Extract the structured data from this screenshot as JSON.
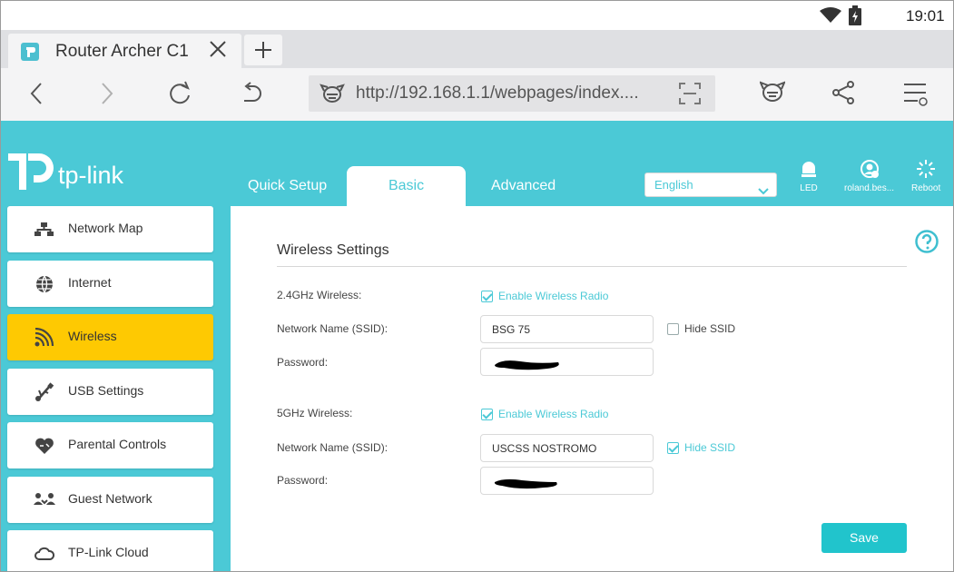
{
  "status": {
    "time": "19:01"
  },
  "browser": {
    "tab_title": "Router Archer C1",
    "url": "http://192.168.1.1/webpages/index...."
  },
  "router": {
    "logo_text": "tp-link",
    "nav": {
      "quick": "Quick Setup",
      "basic": "Basic",
      "advanced": "Advanced"
    },
    "language": "English",
    "header_icons": {
      "led": "LED",
      "user": "roland.bes...",
      "reboot": "Reboot"
    }
  },
  "sidebar": {
    "items": [
      {
        "label": "Network Map",
        "icon": "network-map-icon"
      },
      {
        "label": "Internet",
        "icon": "globe-icon"
      },
      {
        "label": "Wireless",
        "icon": "wifi-icon",
        "active": true
      },
      {
        "label": "USB Settings",
        "icon": "usb-icon"
      },
      {
        "label": "Parental Controls",
        "icon": "heart-icon"
      },
      {
        "label": "Guest Network",
        "icon": "guest-icon"
      },
      {
        "label": "TP-Link Cloud",
        "icon": "cloud-icon"
      }
    ]
  },
  "wireless": {
    "title": "Wireless Settings",
    "band24": {
      "label": "2.4GHz Wireless:",
      "enable_label": "Enable Wireless Radio",
      "enabled": true,
      "ssid_label": "Network Name (SSID):",
      "ssid": "BSG 75",
      "hide_label": "Hide SSID",
      "hide": false,
      "password_label": "Password:"
    },
    "band5": {
      "label": "5GHz Wireless:",
      "enable_label": "Enable Wireless Radio",
      "enabled": true,
      "ssid_label": "Network Name (SSID):",
      "ssid": "USCSS NOSTROMO",
      "hide_label": "Hide SSID",
      "hide": true,
      "password_label": "Password:"
    },
    "save_label": "Save"
  },
  "colors": {
    "accent": "#4bc9d6",
    "active": "#fec902",
    "save": "#21c4cc"
  }
}
